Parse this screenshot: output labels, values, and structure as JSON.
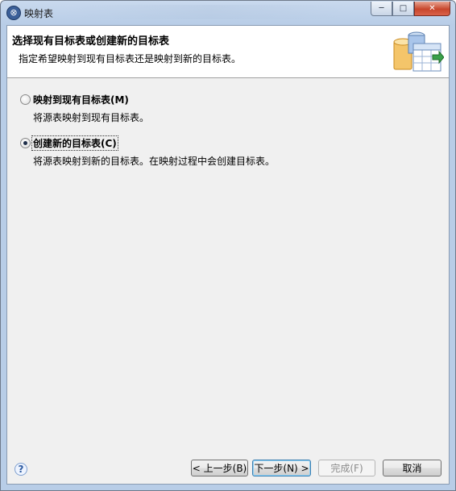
{
  "window": {
    "title": "映射表",
    "controls": {
      "minimize": "─",
      "maximize": "□",
      "close": "✕"
    }
  },
  "header": {
    "title": "选择现有目标表或创建新的目标表",
    "description": "指定希望映射到现有目标表还是映射到新的目标表。"
  },
  "options": [
    {
      "label": "映射到现有目标表(M)",
      "description": "将源表映射到现有目标表。",
      "selected": false
    },
    {
      "label": "创建新的目标表(C)",
      "description": "将源表映射到新的目标表。在映射过程中会创建目标表。",
      "selected": true
    }
  ],
  "buttons": {
    "back": "< 上一步(B)",
    "next": "下一步(N) >",
    "finish": "完成(F)",
    "cancel": "取消"
  },
  "icons": {
    "app": "wizard-app-icon",
    "header": "database-table-map-icon",
    "help": "help-icon"
  }
}
